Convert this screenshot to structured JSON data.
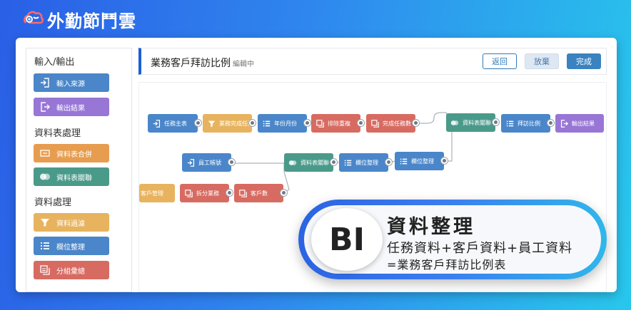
{
  "brand": {
    "name": "外勤節鬥雲"
  },
  "sidebar": {
    "sections": [
      {
        "title": "輸入/輸出",
        "items": [
          {
            "label": "輸入來源",
            "icon": "login-icon",
            "color": "#4a86c9"
          },
          {
            "label": "輸出結果",
            "icon": "logout-icon",
            "color": "#9876d6"
          }
        ]
      },
      {
        "title": "資料表處理",
        "items": [
          {
            "label": "資料表合併",
            "icon": "merge-icon",
            "color": "#e79d4f"
          },
          {
            "label": "資料表關聯",
            "icon": "join-icon",
            "color": "#4a9a8a"
          }
        ]
      },
      {
        "title": "資料處理",
        "items": [
          {
            "label": "資料過濾",
            "icon": "filter-icon",
            "color": "#e8b35e"
          },
          {
            "label": "欄位整理",
            "icon": "list-icon",
            "color": "#4a86c9"
          },
          {
            "label": "分組彙總",
            "icon": "group-icon",
            "color": "#d76b62"
          }
        ]
      }
    ]
  },
  "header": {
    "title": "業務客戶拜訪比例",
    "status": "編輯中",
    "back_label": "返回",
    "discard_label": "放棄",
    "done_label": "完成"
  },
  "flow": {
    "nodes": [
      {
        "label": "任務主表",
        "type": "input"
      },
      {
        "label": "業務完成任務",
        "type": "filter"
      },
      {
        "label": "年份月份",
        "type": "column"
      },
      {
        "label": "排除重複",
        "type": "group"
      },
      {
        "label": "完成任務數",
        "type": "group"
      },
      {
        "label": "資料表關聯",
        "type": "join"
      },
      {
        "label": "拜訪比例",
        "type": "column"
      },
      {
        "label": "輸出結果",
        "type": "output"
      },
      {
        "label": "員工帳號",
        "type": "input"
      },
      {
        "label": "資料表關聯",
        "type": "join"
      },
      {
        "label": "欄位整理",
        "type": "column"
      },
      {
        "label": "欄位整理",
        "type": "column"
      },
      {
        "label": "客戶管理",
        "type": "input"
      },
      {
        "label": "拆分業務",
        "type": "column"
      },
      {
        "label": "客戶數",
        "type": "group"
      }
    ]
  },
  "badge": {
    "logo": "BI",
    "title": "資料整理",
    "line1": "任務資料+客戶資料+員工資料",
    "line2": "=業務客戶拜訪比例表"
  },
  "colors": {
    "accent": "#1c5fd6",
    "done": "#3a83c0"
  }
}
